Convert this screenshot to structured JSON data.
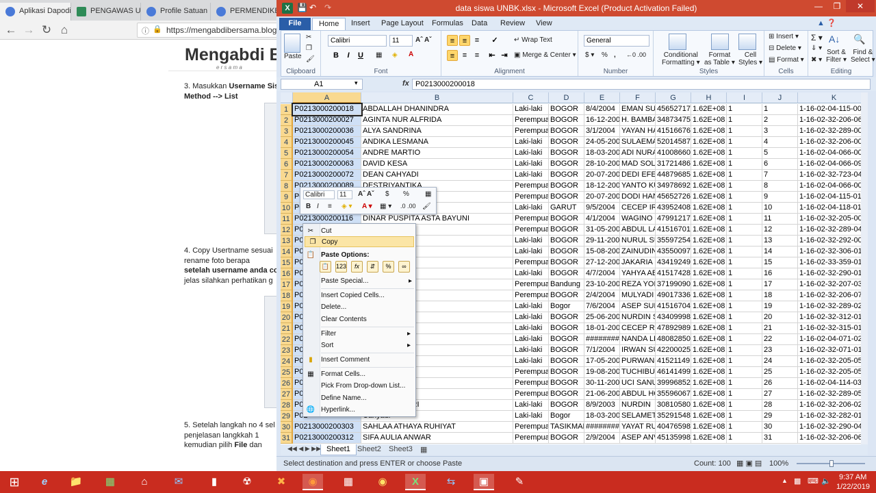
{
  "browser": {
    "tabs": [
      "Aplikasi Dapodik",
      "PENGAWAS USB",
      "Profile Satuan Pe",
      "PERMENDIKBUD"
    ],
    "url": "https://mengabdibersama.blogspot"
  },
  "webpage": {
    "logo": "Mengabdi B",
    "logo_sub": "e r s a m a",
    "step3_a": "3. Masukkan",
    "step3_bold": "Username Sis",
    "step3_b": "Method  -->      List",
    "step4_a": "4. Copy Usertname sesuai",
    "step4_b": "rename foto          berapa",
    "step4_c": "setelah username anda co",
    "step4_d": "jelas silahkan perhatikan g",
    "step5_a": "5. Setelah langkah no 4 sel",
    "step5_b": "penjelasan      langkkah 1",
    "step5_c": "kemudian pilih",
    "step5_file": "File",
    "step5_d": "dan"
  },
  "excel": {
    "title": "data siswa UNBK.xlsx  -  Microsoft Excel (Product Activation Failed)",
    "ribbon_tabs": [
      "File",
      "Home",
      "Insert",
      "Page Layout",
      "Formulas",
      "Data",
      "Review",
      "View"
    ],
    "groups": {
      "clipboard": "Clipboard",
      "font": "Font",
      "alignment": "Alignment",
      "number": "Number",
      "styles": "Styles",
      "cells": "Cells",
      "editing": "Editing"
    },
    "paste": "Paste",
    "font_name": "Calibri",
    "font_size": "11",
    "wrap": "Wrap Text",
    "merge": "Merge & Center",
    "number_format": "General",
    "cond": "Conditional",
    "cond2": "Formatting",
    "fmt_table": "Format",
    "fmt_table2": "as Table",
    "cell_styles": "Cell",
    "cell_styles2": "Styles",
    "insert": "Insert",
    "delete": "Delete",
    "format": "Format",
    "sort": "Sort &",
    "sort2": "Filter",
    "find": "Find &",
    "find2": "Select",
    "name_box": "A1",
    "fx": "fx",
    "formula": "P0213000200018",
    "columns": [
      "A",
      "B",
      "C",
      "D",
      "E",
      "F",
      "G",
      "H",
      "I",
      "J",
      "K"
    ],
    "rows": [
      [
        "P0213000200018",
        "ABDALLAH DHANINDRA",
        "Laki-laki",
        "BOGOR",
        "8/4/2004",
        "EMAN SUI",
        "45652717",
        "1.62E+08",
        "1",
        "1",
        "1-16-02-04-115-001-8"
      ],
      [
        "P0213000200027",
        "AGINTA NUR ALFRIDA",
        "Perempua",
        "BOGOR",
        "16-12-200",
        "H. BAMBA",
        "34873475",
        "1.62E+08",
        "1",
        "2",
        "1-16-02-32-206-066-7"
      ],
      [
        "P0213000200036",
        "ALYA SANDRINA",
        "Perempua",
        "BOGOR",
        "3/1/2004",
        "YAYAN HA",
        "41516676",
        "1.62E+08",
        "1",
        "3",
        "1-16-02-32-289-005-4"
      ],
      [
        "P0213000200045",
        "ANDIKA LESMANA",
        "Laki-laki",
        "BOGOR",
        "24-05-200",
        "SULAEMA",
        "52014587",
        "1.62E+08",
        "1",
        "4",
        "1-16-02-32-206-001-8"
      ],
      [
        "P0213000200054",
        "ANDRE MARTIO",
        "Laki-laki",
        "BOGOR",
        "18-03-200",
        "ADI NURA",
        "41008660",
        "1.62E+08",
        "1",
        "5",
        "1-16-02-04-066-002-7"
      ],
      [
        "P0213000200063",
        "DAVID KESA",
        "Laki-laki",
        "BOGOR",
        "28-10-200",
        "MAD SOLE",
        "31721486",
        "1.62E+08",
        "1",
        "6",
        "1-16-02-04-066-090-2"
      ],
      [
        "P0213000200072",
        "DEAN CAHYADI",
        "Laki-laki",
        "BOGOR",
        "20-07-200",
        "DEDI EFEN",
        "44879685",
        "1.62E+08",
        "1",
        "7",
        "1-16-02-32-723-045-4"
      ],
      [
        "P0213000200089",
        "DESTRIYANTIKA",
        "Perempua",
        "BOGOR",
        "18-12-200",
        "YANTO KU",
        "34978692",
        "1.62E+08",
        "1",
        "8",
        "1-16-02-04-066-006-3"
      ],
      [
        "P0",
        "",
        "Perempua",
        "BOGOR",
        "20-07-200",
        "DODI HAN",
        "45652726",
        "1.62E+08",
        "1",
        "9",
        "1-16-02-04-115-013-6"
      ],
      [
        "P0",
        "RA HIDAYAT",
        "Laki-laki",
        "GARUT",
        "9/5/2004",
        "CECEP IRV",
        "43952408",
        "1.62E+08",
        "1",
        "10",
        "1-16-02-04-118-010-2"
      ],
      [
        "P0213000200116",
        "DINAR PUSPITA ASTA BAYUNI",
        "Perempua",
        "BOGOR",
        "4/1/2004",
        "WAGINO",
        "47991217",
        "1.62E+08",
        "1",
        "11",
        "1-16-02-32-205-007-2"
      ],
      [
        "P0",
        "EWI PRATAMA",
        "Perempua",
        "BOGOR",
        "31-05-200",
        "ABDUL LA",
        "41516701",
        "1.62E+08",
        "1",
        "12",
        "1-16-02-32-289-044-5"
      ],
      [
        "P0",
        "PRASETYA",
        "Laki-laki",
        "BOGOR",
        "29-11-200",
        "NURUL SU",
        "35597254",
        "1.62E+08",
        "1",
        "13",
        "1-16-02-32-292-008-9"
      ],
      [
        "P0",
        "",
        "Laki-laki",
        "BOGOR",
        "15-08-200",
        "ZAINUDIN",
        "43550097",
        "1.62E+08",
        "1",
        "14",
        "1-16-02-32-306-010-7"
      ],
      [
        "P0",
        "I",
        "Perempua",
        "BOGOR",
        "27-12-200",
        "JAKARIA",
        "43419249",
        "1.62E+08",
        "1",
        "15",
        "1-16-02-33-359-014-3"
      ],
      [
        "P0",
        "",
        "Laki-laki",
        "BOGOR",
        "4/7/2004",
        "YAHYA AB",
        "41517428",
        "1.62E+08",
        "1",
        "16",
        "1-16-02-32-290-014-3"
      ],
      [
        "P0",
        "ahrah",
        "Perempua",
        "Bandung",
        "23-10-200",
        "REZA YON",
        "37199090",
        "1.62E+08",
        "1",
        "17",
        "1-16-02-32-207-039-2"
      ],
      [
        "P0",
        "ANI",
        "Perempua",
        "BOGOR",
        "2/4/2004",
        "MULYADI",
        "49017336",
        "1.62E+08",
        "1",
        "18",
        "1-16-02-32-206-077-4"
      ],
      [
        "P0",
        "tnika",
        "Laki-laki",
        "Bogor",
        "7/6/2004",
        "ASEP SUD",
        "41516704",
        "1.62E+08",
        "1",
        "19",
        "1-16-02-32-289-022-3"
      ],
      [
        "P0",
        "ALIK",
        "Laki-laki",
        "BOGOR",
        "25-06-200",
        "NURDIN S",
        "43409998",
        "1.62E+08",
        "1",
        "20",
        "1-16-02-32-312-018-7"
      ],
      [
        "P0",
        "A SOLA",
        "Laki-laki",
        "BOGOR",
        "18-01-200",
        "CECEP RU",
        "47892989",
        "1.62E+08",
        "1",
        "21",
        "1-16-02-32-315-014-3"
      ],
      [
        "P0",
        "ANS",
        "Laki-laki",
        "BOGOR",
        "########",
        "NANDA LE",
        "48082850",
        "1.62E+08",
        "1",
        "22",
        "1-16-02-04-071-021-4"
      ],
      [
        "P0",
        "IF AR-RIZKI",
        "Laki-laki",
        "BOGOR",
        "7/1/2004",
        "IRWAN SU",
        "42200025",
        "1.62E+08",
        "1",
        "23",
        "1-16-02-32-071-017-8"
      ],
      [
        "P0",
        "WIJAYA",
        "Laki-laki",
        "BOGOR",
        "17-05-200",
        "PURWAN1",
        "41521149",
        "1.62E+08",
        "1",
        "24",
        "1-16-02-32-205-055-2"
      ],
      [
        "P0",
        "AMDIANI",
        "Perempua",
        "BOGOR",
        "19-08-200",
        "TUCHIBUN",
        "46141499",
        "1.62E+08",
        "1",
        "25",
        "1-16-02-32-205-056-9"
      ],
      [
        "P0",
        "RAISHA",
        "Perempua",
        "BOGOR",
        "30-11-200",
        "UCI SANU",
        "39996852",
        "1.62E+08",
        "1",
        "26",
        "1-16-02-04-114-035-6"
      ],
      [
        "P0",
        "KHOER",
        "Perempua",
        "BOGOR",
        "21-06-200",
        "ABDUL HC",
        "35596067",
        "1.62E+08",
        "1",
        "27",
        "1-16-02-32-289-058-7"
      ],
      [
        "P0",
        "AD ASRIL PAJRI",
        "Laki-laki",
        "BOGOR",
        "8/9/2003",
        "NURDIN",
        "30810580",
        "1.62E+08",
        "1",
        "28",
        "1-16-02-32-206-027-6"
      ],
      [
        "P02",
        "Cahyadi",
        "Laki-laki",
        "Bogor",
        "18-03-200",
        "SELAMET I",
        "35291548",
        "1.62E+08",
        "1",
        "29",
        "1-16-02-32-282-019-6"
      ],
      [
        "P0213000200303",
        "SAHLAA ATHAYA RUHIYAT",
        "Perempua",
        "TASIKMAL",
        "########",
        "YAYAT RU",
        "40476598",
        "1.62E+08",
        "1",
        "30",
        "1-16-02-32-290-046-3"
      ],
      [
        "P0213000200312",
        "SIFA AULIA ANWAR",
        "Perempua",
        "BOGOR",
        "2/9/2004",
        "ASEP ANV",
        "45135998",
        "1.62E+08",
        "1",
        "31",
        "1-16-02-32-206-064-5"
      ]
    ],
    "sheets": [
      "Sheet1",
      "Sheet2",
      "Sheet3"
    ],
    "status": "Select destination and press ENTER or choose Paste",
    "count": "Count: 100",
    "zoom": "100%"
  },
  "mini_toolbar": {
    "font": "Calibri",
    "size": "11",
    "dollar": "$",
    "percent": "%"
  },
  "context_menu": {
    "cut": "Cut",
    "copy": "Copy",
    "paste_options": "Paste Options:",
    "paste_special": "Paste Special...",
    "insert_copied": "Insert Copied Cells...",
    "delete": "Delete...",
    "clear": "Clear Contents",
    "filter": "Filter",
    "sort": "Sort",
    "comment": "Insert Comment",
    "format_cells": "Format Cells...",
    "pick": "Pick From Drop-down List...",
    "define": "Define Name...",
    "hyperlink": "Hyperlink...",
    "paste_icons": [
      "123",
      "fx"
    ]
  },
  "taskbar": {
    "time": "9:37 AM",
    "date": "1/22/2019"
  }
}
